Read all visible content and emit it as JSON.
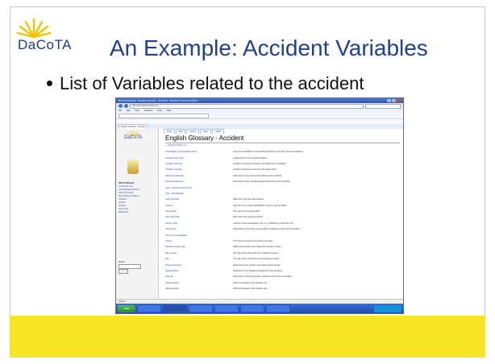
{
  "slide": {
    "logo": "DaCoTA",
    "title": "An Example: Accident Variables",
    "bullet": "List of Variables related to the accident"
  },
  "colors": {
    "title": "#1f3f95",
    "bottom_bar": "#f6e626",
    "link": "#1a47b0",
    "taskbar": "#2b56b8"
  },
  "screenshot": {
    "window_title": "DaCoTA Manual - English Glossary - Accident - Windows Internet Explorer",
    "address": "http://www.dacota-project.eu/...",
    "menu": [
      "File",
      "Edit",
      "View",
      "Favorites",
      "Tools",
      "Help"
    ],
    "page_tabs": [
      "Page",
      "Edit",
      "History",
      "Move",
      "Watch"
    ],
    "glossary_title": "English Glossary - Accident",
    "glossary_sub": "<< Accident (Phase 1) >>",
    "site_logo": "DaCoTA",
    "nav": [
      "DaCoTA Manual",
      "Introduction and",
      "Overview/Management",
      "DaCoTA Tutorial",
      "Methodology Guidance",
      "Variables",
      "Toolkits",
      "Analysis",
      "Forms and",
      "Datasheets"
    ],
    "search_label": "Search",
    "search_button": "Go",
    "status": "Internet",
    "start": "start",
    "rows": [
      {
        "term": "Accessibility to the accident scene",
        "def": "Level of accessibility to the accident location for the first scene investigators"
      },
      {
        "term": "Accident report type",
        "def": "A description of the accident location"
      },
      {
        "term": "Accident summary",
        "def": "Accident summary according to the DaCoTA investigation"
      },
      {
        "term": "Accident summary",
        "def": "Accident summary as found in the police report"
      },
      {
        "term": "Alcohol involvement",
        "def": "Determines if any drivers were influenced by alcohol"
      },
      {
        "term": "Animal involvement",
        "def": "Description of any outside animal involvement in the accident"
      },
      {
        "term": "Area - Accident Environment",
        "def": ""
      },
      {
        "term": "Area - Classification",
        "def": ""
      },
      {
        "term": "Case end date",
        "def": "Date when the case was finished"
      },
      {
        "term": "Case id",
        "def": "Case ID is the unique identification code for each accident"
      },
      {
        "term": "Case leader",
        "def": "The name of the case leader"
      },
      {
        "term": "Case start date",
        "def": "Date when the case was started"
      },
      {
        "term": "Centre name",
        "def": "Location of the investigation unit, e.g. Gothenburg, Hannover, etc."
      },
      {
        "term": "Cloud cover",
        "def": "Description of the cloud cover weather conditions at the time of accident"
      },
      {
        "term": "Country of investigation",
        "def": ""
      },
      {
        "term": "County",
        "def": "The county of where the accident occurred"
      },
      {
        "term": "Derived accident type",
        "def": "Refers the accident type using GDV accident codes"
      },
      {
        "term": "Day of week",
        "def": "The day of the week when the accident occurred"
      },
      {
        "term": "Day",
        "def": "The day of the month when the accident occurred"
      },
      {
        "term": "Drug involvement",
        "def": "Determines if any drivers were influenced by drugs"
      },
      {
        "term": "Fatal accident",
        "def": "Statement of any fatalities resulting from the accident"
      },
      {
        "term": "Fog/mist",
        "def": "Description of the fog weather conditions at the time of accident"
      },
      {
        "term": "Global position",
        "def": "GPS Coordinates of the accident site"
      },
      {
        "term": "Global position",
        "def": "GPS Coordinates of the accident site"
      }
    ]
  }
}
